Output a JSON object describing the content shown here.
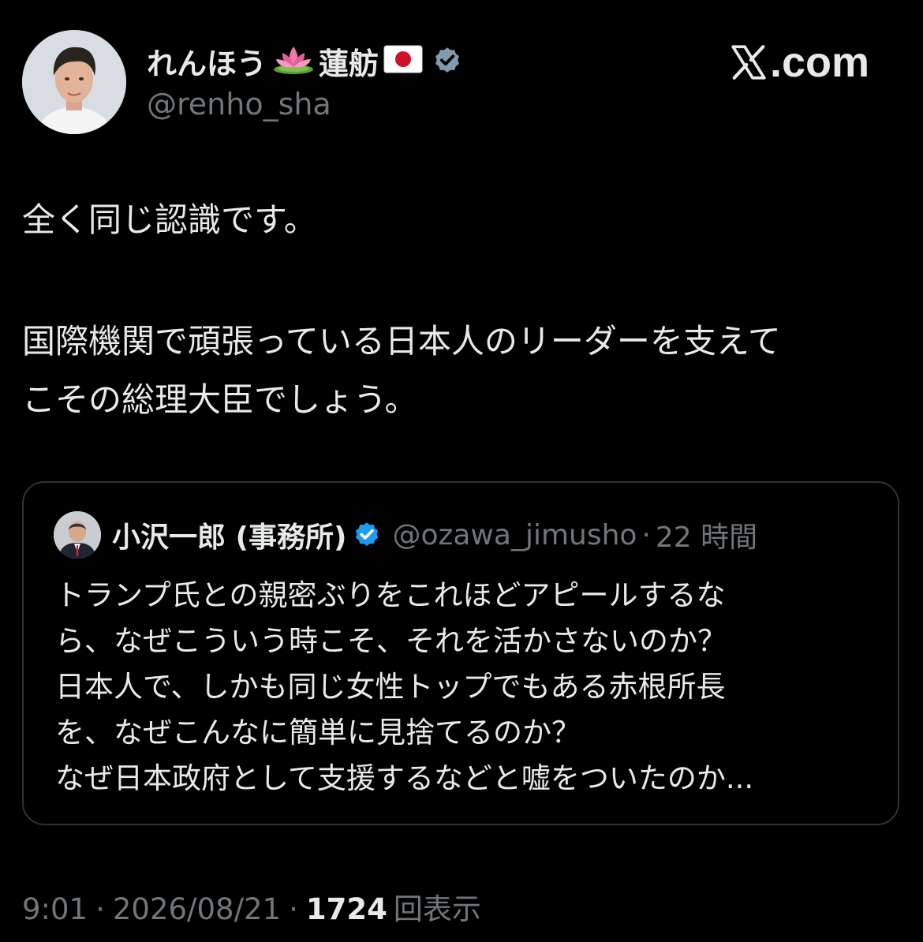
{
  "author": {
    "name_part1": "れんほう",
    "name_part2": "蓮舫",
    "handle": "@renho_sha",
    "lotus_icon": "lotus-emoji-icon",
    "flag_icon": "japan-flag-icon",
    "verified_icon": "verified-badge-icon",
    "verified_color": "#829aab"
  },
  "brand": {
    "icon": "x-logo-icon",
    "text": ".com"
  },
  "tweet": {
    "line1": "全く同じ認識です。",
    "line2": "国際機関で頑張っている日本人のリーダーを支えて",
    "line3": "こその総理大臣でしょう。"
  },
  "quote": {
    "name": "小沢一郎 (事務所)",
    "verified_icon": "verified-badge-icon",
    "verified_color": "#1d9bf0",
    "handle": "@ozawa_jimusho",
    "separator": "·",
    "time": "22 時間",
    "lines": [
      "トランプ氏との親密ぶりをこれほどアピールするな",
      "ら、なぜこういう時こそ、それを活かさないのか？",
      "日本人で、しかも同じ女性トップでもある赤根所長",
      "を、なぜこんなに簡単に見捨てるのか？",
      "なぜ日本政府として支援するなどと嘘をついたのか..."
    ]
  },
  "meta": {
    "time": "9:01",
    "separator": "·",
    "date": "2026/08/21",
    "views_count": "1724",
    "views_label": "回表示"
  },
  "colors": {
    "background": "#000000",
    "text_primary": "#e7e9ea",
    "text_secondary": "#71767b",
    "border": "#2f3336"
  }
}
